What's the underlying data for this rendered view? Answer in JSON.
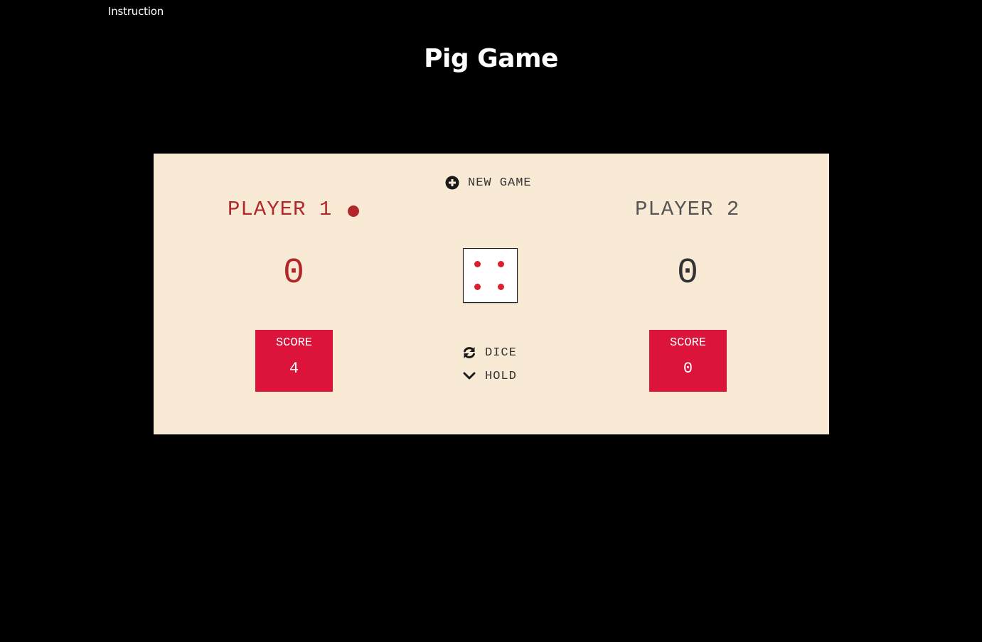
{
  "header": {
    "instruction_link": "Instruction",
    "title": "Pig Game"
  },
  "controls": {
    "new_game_label": "NEW GAME",
    "roll_dice_label": "DICE",
    "hold_label": "HOLD"
  },
  "players": [
    {
      "name": "PLAYER 1",
      "current": "0",
      "score_label": "SCORE",
      "score": "4",
      "active": true
    },
    {
      "name": "PLAYER 2",
      "current": "0",
      "score_label": "SCORE",
      "score": "0",
      "active": false
    }
  ],
  "dice": {
    "value": 4
  },
  "colors": {
    "background": "#000000",
    "board": "#f9ead6",
    "accent": "#dc143c",
    "active_player": "#b2282a",
    "dice_pip": "#d9202f"
  },
  "icons": {
    "new_game": "plus-circle-icon",
    "roll": "refresh-icon",
    "hold": "chevron-down-icon",
    "active": "active-player-dot-icon"
  }
}
